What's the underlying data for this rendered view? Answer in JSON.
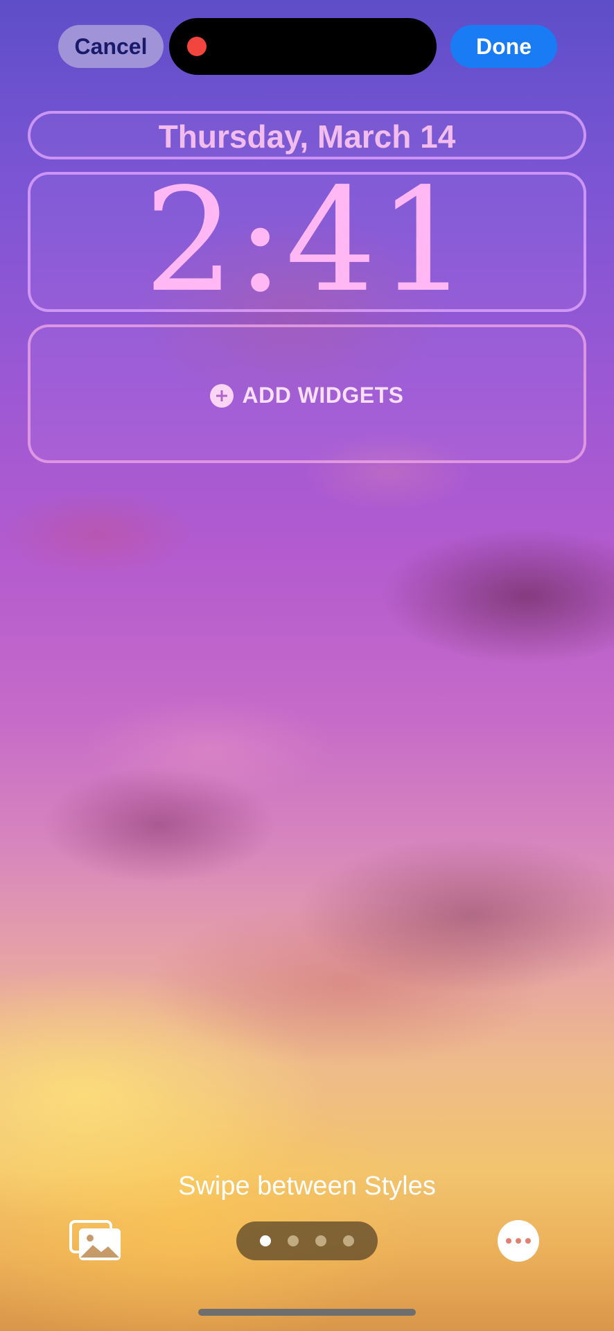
{
  "top_bar": {
    "cancel_label": "Cancel",
    "done_label": "Done"
  },
  "lock_screen": {
    "date": "Thursday, March 14",
    "time": "2:41",
    "add_widgets_label": "ADD WIDGETS"
  },
  "bottom": {
    "hint": "Swipe between Styles",
    "style_pages_count": 4,
    "active_style_index": 0,
    "icons": [
      "photos-icon",
      "more-icon"
    ]
  },
  "colors": {
    "done_button": "#1a7cf5",
    "time_text": "#ffb8f4",
    "recording_dot": "#f2453d"
  }
}
